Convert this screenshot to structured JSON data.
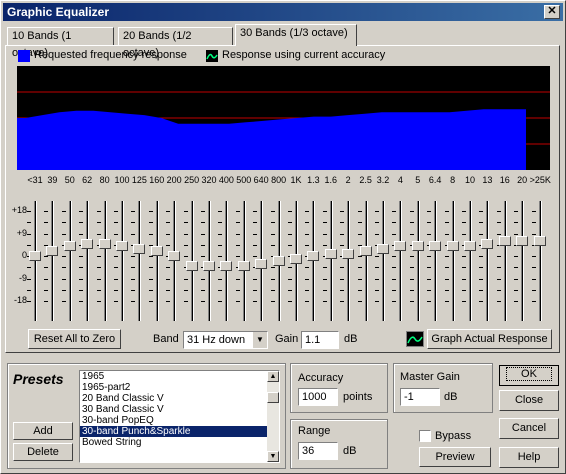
{
  "window": {
    "title": "Graphic Equalizer"
  },
  "tabs": [
    {
      "label": "10 Bands (1 octave)"
    },
    {
      "label": "20 Bands (1/2 octave)"
    },
    {
      "label": "30 Bands (1/3 octave)"
    }
  ],
  "legend": {
    "requested": "Requested frequency response",
    "actual": "Response using current accuracy",
    "requested_color": "#0000ff"
  },
  "freq_labels": [
    "<31",
    "39",
    "50",
    "62",
    "80",
    "100",
    "125",
    "160",
    "200",
    "250",
    "320",
    "400",
    "500",
    "640",
    "800",
    "1K",
    "1.3",
    "1.6",
    "2",
    "2.5",
    "3.2",
    "4",
    "5",
    "6.4",
    "8",
    "10",
    "13",
    "16",
    "20",
    ">25K"
  ],
  "db_labels": [
    "+18",
    "+9",
    "0",
    "-9",
    "-18"
  ],
  "chart_data": {
    "type": "area",
    "categories": [
      "<31",
      "39",
      "50",
      "62",
      "80",
      "100",
      "125",
      "160",
      "200",
      "250",
      "320",
      "400",
      "500",
      "640",
      "800",
      "1K",
      "1.3",
      "1.6",
      "2",
      "2.5",
      "3.2",
      "4",
      "5",
      "6.4",
      "8",
      "10",
      "13",
      "16",
      "20",
      ">25K"
    ],
    "values": [
      0,
      2,
      4,
      5,
      5,
      4,
      3,
      2,
      0,
      -4,
      -4,
      -4,
      -4,
      -3,
      -2,
      -1,
      0,
      1,
      1,
      2,
      3,
      4,
      4,
      4,
      4,
      4,
      5,
      6,
      6,
      6
    ],
    "ylim": [
      -18,
      18
    ]
  },
  "controls": {
    "reset_label": "Reset All to Zero",
    "band_label": "Band",
    "band_value": "31 Hz down",
    "gain_label": "Gain",
    "gain_value": "1.1",
    "gain_unit": "dB",
    "graph_actual_label": "Graph Actual Response"
  },
  "presets": {
    "title": "Presets",
    "add_label": "Add",
    "delete_label": "Delete",
    "items": [
      "1965",
      "1965-part2",
      "20 Band Classic V",
      "30 Band Classic V",
      "30-band PopEQ",
      "30-band Punch&Sparkle",
      "Bowed String"
    ],
    "selected": "30-band Punch&Sparkle"
  },
  "accuracy": {
    "label": "Accuracy",
    "value": "1000",
    "unit": "points"
  },
  "range": {
    "label": "Range",
    "value": "36",
    "unit": "dB"
  },
  "master_gain": {
    "label": "Master Gain",
    "value": "-1",
    "unit": "dB"
  },
  "bypass": {
    "label": "Bypass",
    "checked": false
  },
  "buttons": {
    "ok": "OK",
    "close": "Close",
    "cancel": "Cancel",
    "preview": "Preview",
    "help": "Help"
  }
}
